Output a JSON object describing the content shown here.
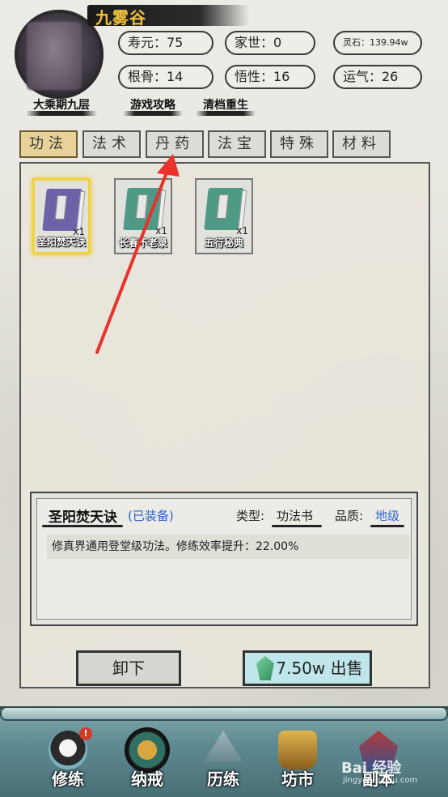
{
  "header": {
    "character_name": "九雾谷",
    "realm": "大乘期九层",
    "links": [
      "游戏攻略",
      "清档重生"
    ],
    "stats": {
      "lifespan": "寿元：75",
      "family": "家世：0",
      "spirit_stones": "灵石：139.94w",
      "bone": "根骨：14",
      "comprehension": "悟性：16",
      "luck": "运气：26"
    }
  },
  "tabs": [
    {
      "label": "功法",
      "active": true
    },
    {
      "label": "法术",
      "active": false
    },
    {
      "label": "丹药",
      "active": false
    },
    {
      "label": "法宝",
      "active": false
    },
    {
      "label": "特殊",
      "active": false
    },
    {
      "label": "材料",
      "active": false
    }
  ],
  "items": [
    {
      "name": "圣阳焚天诀",
      "qty": "x1",
      "selected": true,
      "cover": "#6b62a8"
    },
    {
      "name": "长春不老录",
      "qty": "x1",
      "selected": false,
      "cover": "#4e9a86"
    },
    {
      "name": "五行秘典",
      "qty": "x1",
      "selected": false,
      "cover": "#4e9a86"
    }
  ],
  "detail": {
    "title": "圣阳焚天诀",
    "equipped": "(已装备)",
    "type_label": "类型:",
    "type_value": "功法书",
    "grade_label": "品质:",
    "grade_value": "地级",
    "description": "修真界通用登堂级功法。修练效率提升：22.00%"
  },
  "buttons": {
    "unequip": "卸下",
    "sell": "7.50w 出售"
  },
  "nav": [
    {
      "label": "修练",
      "badge": "!"
    },
    {
      "label": "纳戒",
      "active": true
    },
    {
      "label": "历练"
    },
    {
      "label": "坊市"
    },
    {
      "label": "副本"
    }
  ],
  "watermark": {
    "text": "Bai 经验",
    "sub": "jingyan.baidu.com"
  },
  "colors": {
    "accent_gold": "#f1c23a",
    "equipped_blue": "#2c65cf",
    "annotation_red": "#e8322a",
    "nav_teal": "#5f8a91"
  }
}
